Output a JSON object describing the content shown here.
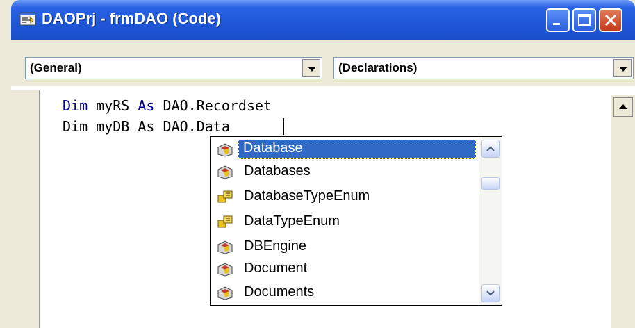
{
  "window": {
    "title": "DAOPrj - frmDAO (Code)",
    "icons": [
      "vb-code-window-icon"
    ],
    "buttons": [
      "minimize",
      "maximize",
      "close"
    ]
  },
  "combos": {
    "object": "(General)",
    "procedure": "(Declarations)"
  },
  "code": {
    "line1": {
      "kw1": "Dim",
      "name": "myRS",
      "kw2": "As",
      "type": "DAO.Recordset"
    },
    "line2": {
      "kw1": "Dim",
      "name": "myDB",
      "kw2": "As",
      "type": "DAO.Data"
    }
  },
  "autocomplete": {
    "items": [
      {
        "label": "Database",
        "icon": "class-icon",
        "selected": true
      },
      {
        "label": "Databases",
        "icon": "class-icon",
        "selected": false
      },
      {
        "label": "DatabaseTypeEnum",
        "icon": "enum-icon",
        "selected": false
      },
      {
        "label": "DataTypeEnum",
        "icon": "enum-icon",
        "selected": false
      },
      {
        "label": "DBEngine",
        "icon": "class-icon",
        "selected": false
      },
      {
        "label": "Document",
        "icon": "class-icon",
        "selected": false
      },
      {
        "label": "Documents",
        "icon": "class-icon",
        "selected": false
      }
    ]
  },
  "colors": {
    "titlebar": "#1f57d8",
    "keyword": "#00008b",
    "selection": "#316ac5",
    "chrome": "#ece9d8"
  }
}
